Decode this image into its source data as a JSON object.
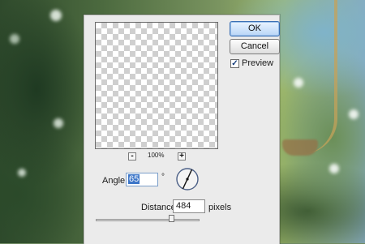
{
  "dialog": {
    "buttons": {
      "ok": "OK",
      "cancel": "Cancel"
    },
    "preview_checkbox": {
      "label": "Preview",
      "checked": true
    },
    "zoom": {
      "minus": "-",
      "plus": "+",
      "level": "100%"
    },
    "angle": {
      "label": "Angle:",
      "value": "65",
      "unit": "°"
    },
    "distance": {
      "label": "Distance:",
      "value": "484",
      "unit": "pixels",
      "slider_fraction": 0.75
    }
  }
}
